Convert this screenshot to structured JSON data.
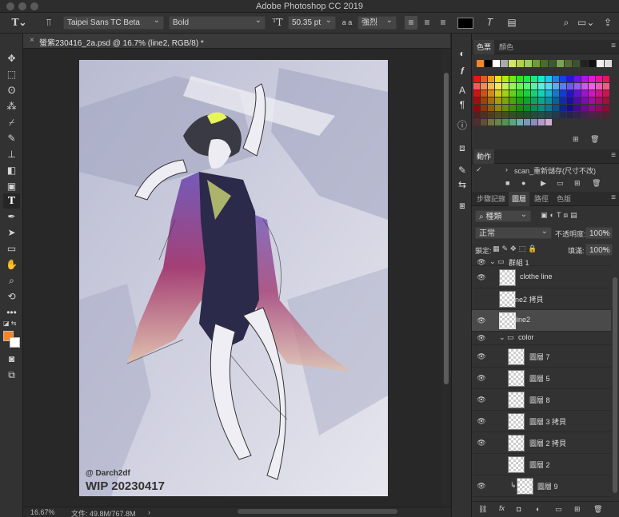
{
  "app": {
    "title": "Adobe Photoshop CC 2019"
  },
  "options": {
    "font_family": "Taipei Sans TC Beta",
    "font_style": "Bold",
    "font_size": "50.35 pt",
    "aa_label": "a a",
    "antialias": "強烈",
    "text_color": "#000000"
  },
  "document": {
    "tab_title": "螢紫230416_2a.psd @ 16.7% (line2, RGB/8) *",
    "zoom": "16.67%",
    "file_info": "文件: 49.8M/767.8M",
    "canvas_credit": "@ Darch2df",
    "canvas_watermark": "WIP 20230417"
  },
  "swatches_panel": {
    "tabs": [
      "色票",
      "顏色"
    ],
    "active_tab": "色票",
    "recent": [
      "#f4842a",
      "#000000",
      "#ffffff",
      "#a9a9a9",
      "#d6e46f",
      "#b5cf4f",
      "#9ccc65",
      "#6f9b3e",
      "#4a6b2b",
      "#3d5a2a",
      "#7aa450",
      "#556b2f",
      "#3b5330",
      "#222222",
      "#111111",
      "#efefef",
      "#dddddd"
    ]
  },
  "actions_panel": {
    "title": "動作",
    "item": "scan_重新儲存(尺寸不改)"
  },
  "layers_panel": {
    "tabs": [
      "步驟記錄",
      "圖層",
      "路徑",
      "色版"
    ],
    "active_tab": "圖層",
    "filter_label": "種類",
    "blend_mode": "正常",
    "opacity_label": "不透明度:",
    "opacity": "100%",
    "lock_label": "鎖定:",
    "fill_label": "填滿:",
    "fill": "100%",
    "layers": [
      {
        "name": "群組 1",
        "type": "group",
        "visible": true,
        "indent": 0
      },
      {
        "name": "clothe line",
        "type": "layer",
        "visible": true,
        "indent": 1
      },
      {
        "name": "line2 拷貝",
        "type": "layer",
        "visible": false,
        "indent": 1
      },
      {
        "name": "line2",
        "type": "layer",
        "visible": true,
        "indent": 1,
        "selected": true
      },
      {
        "name": "color",
        "type": "group",
        "visible": true,
        "indent": 1
      },
      {
        "name": "圖層 7",
        "type": "layer",
        "visible": true,
        "indent": 2
      },
      {
        "name": "圖層 5",
        "type": "layer",
        "visible": true,
        "indent": 2
      },
      {
        "name": "圖層 8",
        "type": "layer",
        "visible": true,
        "indent": 2
      },
      {
        "name": "圖層 3 拷貝",
        "type": "layer",
        "visible": true,
        "indent": 2
      },
      {
        "name": "圖層 2 拷貝",
        "type": "layer",
        "visible": true,
        "indent": 2
      },
      {
        "name": "圖層 2",
        "type": "layer",
        "visible": false,
        "indent": 2
      },
      {
        "name": "圖層 9",
        "type": "layer",
        "visible": true,
        "indent": 2,
        "clipped": true
      }
    ]
  },
  "tool_colors": {
    "foreground": "#f4842a",
    "background": "#ffffff"
  }
}
